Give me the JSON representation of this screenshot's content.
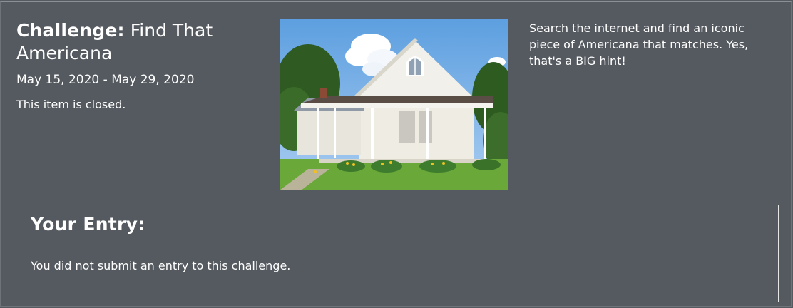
{
  "challenge": {
    "label": "Challenge:",
    "name": "Find That Americana",
    "dates": "May 15, 2020 - May 29, 2020",
    "status": "This item is closed.",
    "description": "Search the internet and find an iconic piece of Americana that matches. Yes, that's a BIG hint!"
  },
  "entry": {
    "title": "Your Entry:",
    "message": "You did not submit an entry to this challenge."
  },
  "colors": {
    "background": "#555a60",
    "text": "#ffffff",
    "entry_border": "#e6e6e6"
  }
}
